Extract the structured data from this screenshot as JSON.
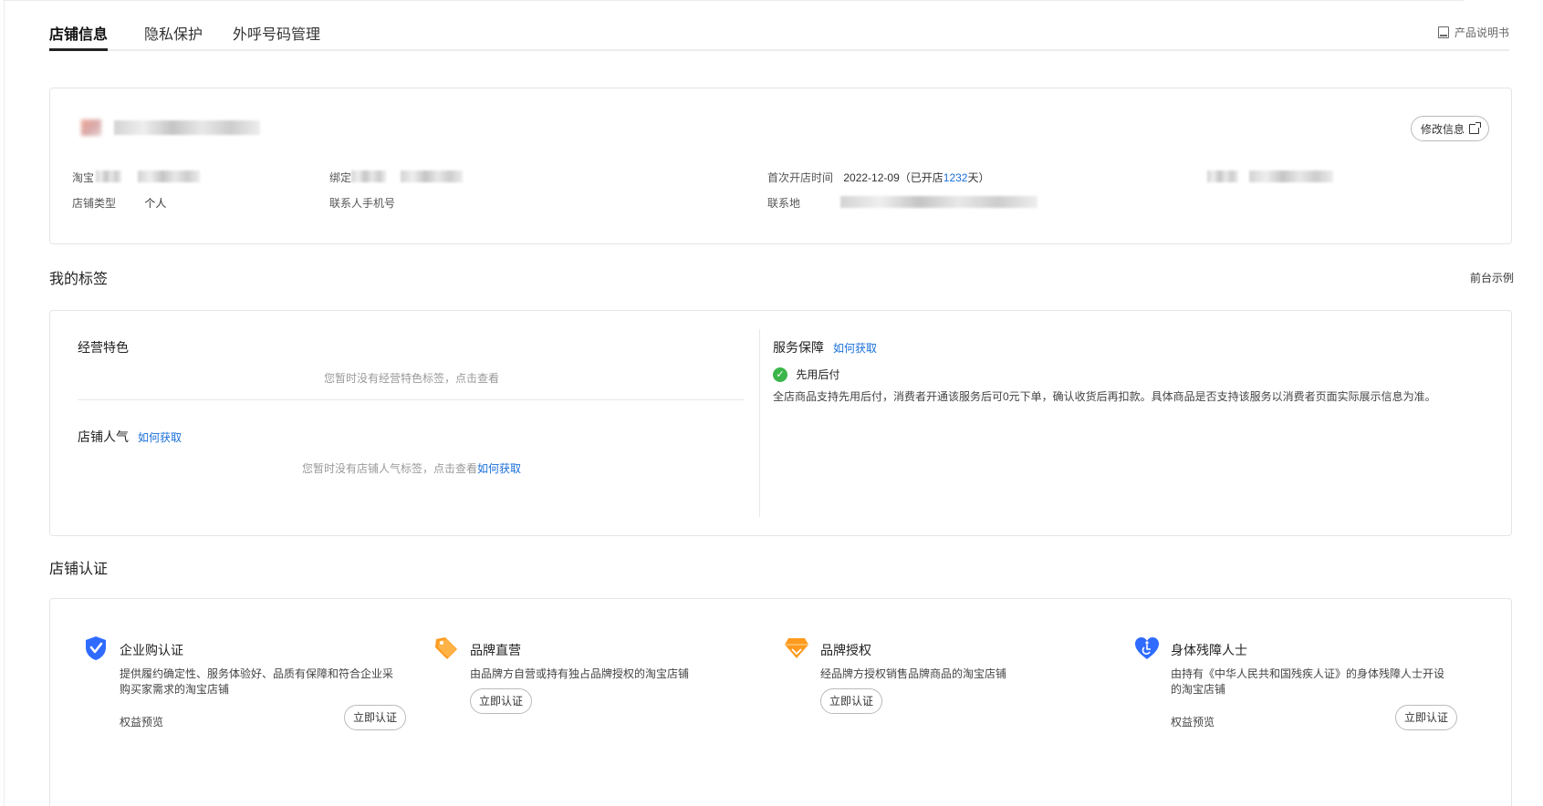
{
  "tabs": [
    {
      "label": "店铺信息",
      "active": true
    },
    {
      "label": "隐私保护",
      "active": false
    },
    {
      "label": "外呼号码管理",
      "active": false
    }
  ],
  "manual_label": "产品说明书",
  "shop": {
    "edit_label": "修改信息",
    "fields": {
      "taobao_label": "淘宝",
      "bind_label": "绑定",
      "first_open_label": "首次开店时间",
      "first_open_date": "2022-12-09",
      "open_prefix": "（已开店",
      "open_days": "1232",
      "open_suffix": "天）",
      "shop_type_label": "店铺类型",
      "shop_type_value": "个人",
      "contact_phone_label": "联系人手机号",
      "contact_addr_label": "联系地"
    }
  },
  "tags": {
    "title": "我的标签",
    "example_label": "前台示例",
    "feature": {
      "title": "经营特色",
      "empty": "您暂时没有经营特色标签，点击查看"
    },
    "popularity": {
      "title": "店铺人气",
      "how": "如何获取",
      "empty": "您暂时没有店铺人气标签，点击查看",
      "empty_link": "如何获取"
    },
    "service": {
      "title": "服务保障",
      "how": "如何获取",
      "item_name": "先用后付",
      "item_desc": "全店商品支持先用后付，消费者开通该服务后可0元下单，确认收货后再扣款。具体商品是否支持该服务以消费者页面实际展示信息为准。"
    }
  },
  "cert": {
    "title": "店铺认证",
    "items": [
      {
        "name": "企业购认证",
        "desc": "提供履约确定性、服务体验好、品质有保障和符合企业采购买家需求的淘宝店铺",
        "benefit": "权益预览",
        "button": "立即认证",
        "icon": "shield-check-icon",
        "color": "#2f6bff"
      },
      {
        "name": "品牌直营",
        "desc": "由品牌方自营或持有独占品牌授权的淘宝店铺",
        "button": "立即认证",
        "icon": "price-tag-icon",
        "color": "#ff9a1f"
      },
      {
        "name": "品牌授权",
        "desc": "经品牌方授权销售品牌商品的淘宝店铺",
        "button": "立即认证",
        "icon": "diamond-icon",
        "color": "#ff9a1f"
      },
      {
        "name": "身体残障人士",
        "desc": "由持有《中华人民共和国残疾人证》的身体残障人士开设的淘宝店铺",
        "benefit": "权益预览",
        "button": "立即认证",
        "icon": "accessibility-heart-icon",
        "color": "#2f6bff"
      }
    ]
  }
}
